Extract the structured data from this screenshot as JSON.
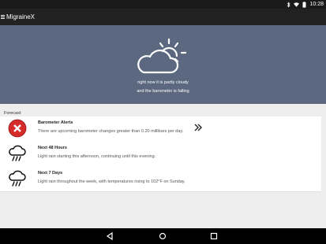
{
  "status_bar": {
    "time": "10:28",
    "icons": [
      "bluetooth-icon",
      "wifi-icon",
      "battery-icon"
    ]
  },
  "app_bar": {
    "title": "MigraineX"
  },
  "hero": {
    "icon": "partly-cloudy-icon",
    "line1": "right now it is partly cloudy",
    "line2": "and the barometer is falling"
  },
  "forecast": {
    "section_label": "Forecast",
    "items": [
      {
        "icon": "alert-x-icon",
        "title": "Barometer Alerts",
        "description": "There are upcoming barometer changes greater than 0.20 millibars per day.",
        "action_icon": "double-chevron-right-icon"
      },
      {
        "icon": "rain-cloud-icon",
        "title": "Next 48 Hours",
        "description": "Light rain starting this afternoon, continuing until this evening."
      },
      {
        "icon": "rain-cloud-icon",
        "title": "Next 7 Days",
        "description": "Light rain throughout the week, with temperatures rising to 102°F on Sunday."
      }
    ]
  },
  "nav_bar": {
    "buttons": [
      "back-icon",
      "home-icon",
      "recents-icon"
    ]
  },
  "colors": {
    "hero_bg": "#5b687f",
    "app_bar_bg": "#212121",
    "alert_red": "#d62b2b"
  }
}
